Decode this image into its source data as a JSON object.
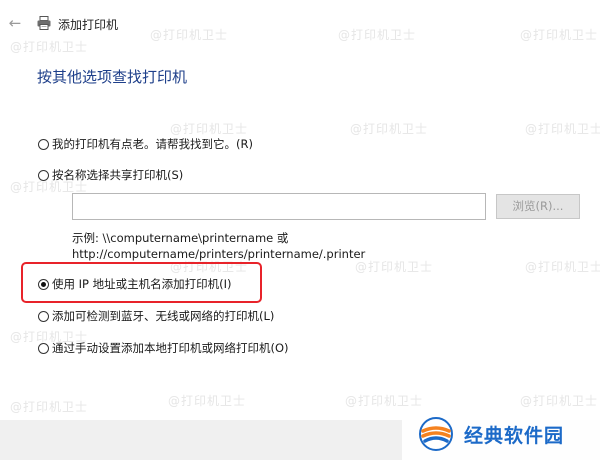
{
  "window": {
    "title": "添加打印机",
    "back_icon": "back-arrow-icon",
    "title_icon": "printer-icon"
  },
  "heading": "按其他选项查找打印机",
  "options": [
    {
      "label": "我的打印机有点老。请帮我找到它。(R)",
      "checked": false
    },
    {
      "label": "按名称选择共享打印机(S)",
      "checked": false
    },
    {
      "label": "使用 IP 地址或主机名添加打印机(I)",
      "checked": true
    },
    {
      "label": "添加可检测到蓝牙、无线或网络的打印机(L)",
      "checked": false
    },
    {
      "label": "通过手动设置添加本地打印机或网络打印机(O)",
      "checked": false
    }
  ],
  "share": {
    "input_value": "",
    "browse_label": "浏览(R)...",
    "example_line1": "示例: \\\\computername\\printername 或",
    "example_line2": "http://computername/printers/printername/.printer"
  },
  "watermark": "@打印机卫士",
  "logo": {
    "text": "经典软件园",
    "colors": {
      "text": "#1c6ac8",
      "orange": "#f5821f",
      "blue": "#1c6ac8"
    }
  },
  "colors": {
    "heading": "#1e3f8a",
    "highlight_border": "#e8232a",
    "bottom_bar": "#f0f0f0"
  }
}
